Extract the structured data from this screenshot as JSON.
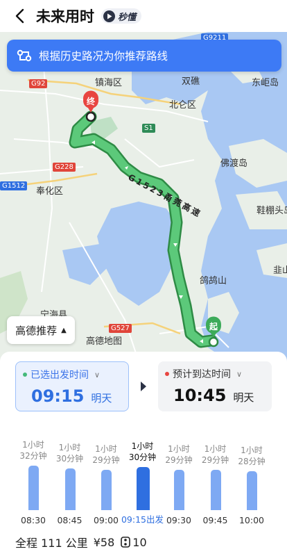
{
  "header": {
    "title": "未来用时",
    "badge": "秒懂"
  },
  "suggest": {
    "text": "根据历史路况为你推荐路线"
  },
  "map": {
    "labels": [
      "镇海区",
      "北仑区",
      "双礁",
      "东岠岛",
      "奉化区",
      "佛渡岛",
      "鞋棚头岛",
      "鸽鸪山",
      "韭山",
      "宁海县",
      "高德地图"
    ],
    "shields": [
      "G92",
      "S1",
      "G228",
      "G1512",
      "G527",
      "G9211"
    ],
    "end_marker": "终",
    "start_marker": "起",
    "road_name": "G1523甬莞高速"
  },
  "route_pref": {
    "label": "高德推荐"
  },
  "depart": {
    "label": "已选出发时间",
    "time": "09:15",
    "day": "明天"
  },
  "arrive": {
    "label": "预计到达时间",
    "time": "10:45",
    "day": "明天"
  },
  "options": [
    {
      "duration": "1小时\n32分钟",
      "time": "08:30",
      "minutes": 92
    },
    {
      "duration": "1小时\n30分钟",
      "time": "08:45",
      "minutes": 90
    },
    {
      "duration": "1小时\n29分钟",
      "time": "09:00",
      "minutes": 89
    },
    {
      "duration": "1小时\n30分钟",
      "time": "09:15出发",
      "minutes": 90,
      "selected": true
    },
    {
      "duration": "1小时\n29分钟",
      "time": "09:30",
      "minutes": 89
    },
    {
      "duration": "1小时\n29分钟",
      "time": "09:45",
      "minutes": 89
    },
    {
      "duration": "1小时\n28分钟",
      "time": "10:00",
      "minutes": 88
    }
  ],
  "summary": {
    "distance": "全程 111 公里",
    "toll": "¥58",
    "lights": "10"
  },
  "colors": {
    "accent": "#2f6fe0",
    "route": "#4cb76a",
    "bar": "#7ea9f3"
  }
}
